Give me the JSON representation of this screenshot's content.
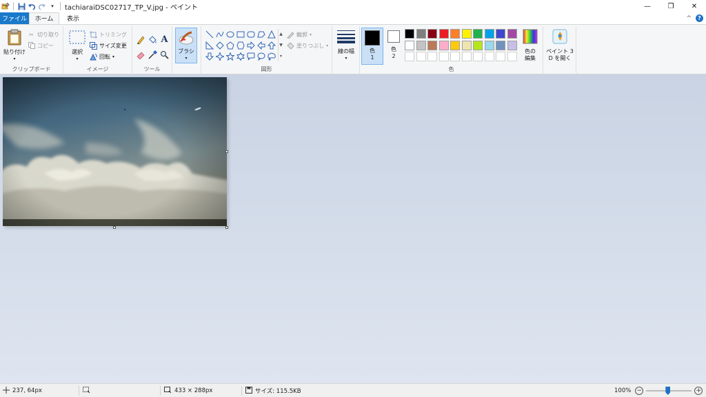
{
  "window": {
    "title": "tachiaraiDSC02717_TP_V.jpg - ペイント",
    "minimize": "—",
    "restore": "❐",
    "close": "✕"
  },
  "tabs": {
    "file": "ファイル",
    "home": "ホーム",
    "view": "表示",
    "collapse": "^",
    "help": "?"
  },
  "ribbon": {
    "clipboard": {
      "label": "クリップボード",
      "paste": "貼り付け",
      "cut": "切り取り",
      "copy": "コピー"
    },
    "image": {
      "label": "イメージ",
      "select": "選択",
      "crop": "トリミング",
      "resize": "サイズ変更",
      "rotate": "回転"
    },
    "tools": {
      "label": "ツール"
    },
    "brushes": {
      "label": "ブラシ"
    },
    "shapes": {
      "label": "図形",
      "outline": "輪郭",
      "fill": "塗りつぶし"
    },
    "size": {
      "label": "線の幅"
    },
    "colors": {
      "label": "色",
      "color1": "色",
      "color1_num": "1",
      "color2": "色",
      "color2_num": "2",
      "edit_line1": "色の",
      "edit_line2": "編集",
      "color1_value": "#000000",
      "color2_value": "#ffffff",
      "swatches_row1": [
        "#000000",
        "#7f7f7f",
        "#880015",
        "#ed1c24",
        "#ff7f27",
        "#fff200",
        "#22b14c",
        "#00a2e8",
        "#3f48cc",
        "#a349a4"
      ],
      "swatches_row2": [
        "#ffffff",
        "#c3c3c3",
        "#b97a57",
        "#ffaec9",
        "#ffc90e",
        "#efe4b0",
        "#b5e61d",
        "#99d9ea",
        "#7092be",
        "#c8bfe7"
      ]
    },
    "paint3d": {
      "line1": "ペイント 3",
      "line2": "D を開く"
    }
  },
  "status": {
    "cursor_pos": "237, 64px",
    "image_dims": "433 × 288px",
    "file_size": "サイズ: 115.5KB",
    "zoom": "100%",
    "zoom_level": 1.0
  }
}
